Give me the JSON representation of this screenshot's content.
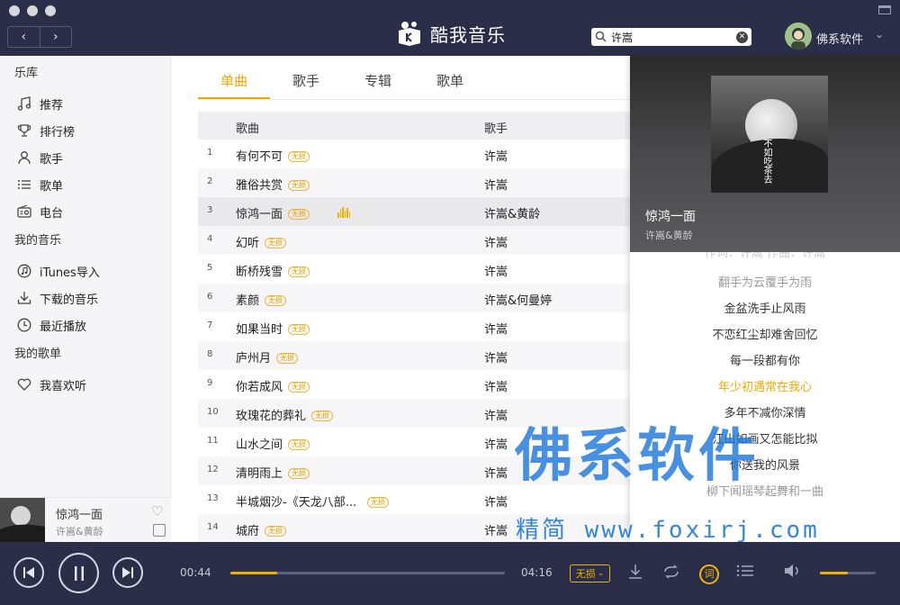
{
  "app": {
    "title": "酷我音乐"
  },
  "nav": {
    "back": "‹",
    "forward": "›"
  },
  "search": {
    "value": "许嵩",
    "placeholder": ""
  },
  "user": {
    "name": "佛系软件"
  },
  "sidebar": {
    "library_heading": "乐库",
    "library_items": [
      {
        "label": "推荐",
        "icon": "music-note-icon"
      },
      {
        "label": "排行榜",
        "icon": "trophy-icon"
      },
      {
        "label": "歌手",
        "icon": "person-icon"
      },
      {
        "label": "歌单",
        "icon": "list-icon"
      },
      {
        "label": "电台",
        "icon": "radio-icon"
      }
    ],
    "my_music_heading": "我的音乐",
    "my_music_items": [
      {
        "label": "iTunes导入",
        "icon": "itunes-icon"
      },
      {
        "label": "下载的音乐",
        "icon": "download-icon"
      },
      {
        "label": "最近播放",
        "icon": "clock-icon"
      }
    ],
    "my_playlist_heading": "我的歌单",
    "my_playlist_items": [
      {
        "label": "我喜欢听",
        "icon": "heart-icon"
      }
    ]
  },
  "now_playing": {
    "title": "惊鸿一面",
    "artist": "许嵩&黄龄"
  },
  "tabs": [
    {
      "label": "单曲",
      "active": true
    },
    {
      "label": "歌手",
      "active": false
    },
    {
      "label": "专辑",
      "active": false
    },
    {
      "label": "歌单",
      "active": false
    }
  ],
  "table": {
    "headers": {
      "song": "歌曲",
      "artist": "歌手"
    },
    "lossless_badge": "无损",
    "rows": [
      {
        "num": "1",
        "title": "有何不可",
        "artist": "许嵩"
      },
      {
        "num": "2",
        "title": "雅俗共赏",
        "artist": "许嵩"
      },
      {
        "num": "3",
        "title": "惊鸿一面",
        "artist": "许嵩&黄龄"
      },
      {
        "num": "4",
        "title": "幻听",
        "artist": "许嵩"
      },
      {
        "num": "5",
        "title": "断桥残雪",
        "artist": "许嵩"
      },
      {
        "num": "6",
        "title": "素颜",
        "artist": "许嵩&何曼婷"
      },
      {
        "num": "7",
        "title": "如果当时",
        "artist": "许嵩"
      },
      {
        "num": "8",
        "title": "庐州月",
        "artist": "许嵩"
      },
      {
        "num": "9",
        "title": "你若成风",
        "artist": "许嵩"
      },
      {
        "num": "10",
        "title": "玫瑰花的葬礼",
        "artist": "许嵩"
      },
      {
        "num": "11",
        "title": "山水之间",
        "artist": "许嵩"
      },
      {
        "num": "12",
        "title": "清明雨上",
        "artist": "许嵩"
      },
      {
        "num": "13",
        "title": "半城烟沙-《天龙八部...",
        "artist": "许嵩"
      },
      {
        "num": "14",
        "title": "城府",
        "artist": "许嵩"
      }
    ]
  },
  "panel": {
    "title": "惊鸿一面",
    "artist": "许嵩&黄龄",
    "album_text": "不如吃茶去",
    "lyrics": [
      {
        "text": "作词：许嵩 作曲：许嵩",
        "style": "faint"
      },
      {
        "text": "翻手为云覆手为雨",
        "style": "dim"
      },
      {
        "text": "金盆洗手止风雨",
        "style": "normal"
      },
      {
        "text": "不恋红尘却难舍回忆",
        "style": "normal"
      },
      {
        "text": "每一段都有你",
        "style": "normal"
      },
      {
        "text": "年少初遇常在我心",
        "style": "current"
      },
      {
        "text": "多年不减你深情",
        "style": "normal"
      },
      {
        "text": "江山如画又怎能比拟",
        "style": "normal"
      },
      {
        "text": "你送我的风景",
        "style": "normal"
      },
      {
        "text": "柳下闻瑶琴起舞和一曲",
        "style": "dim"
      }
    ]
  },
  "watermark": {
    "text": "佛系软件",
    "sub": "精简 www.foxirj.com"
  },
  "player": {
    "elapsed": "00:44",
    "total": "04:16",
    "progress": 0.17,
    "quality": "无损",
    "lyrics_btn": "词",
    "volume": 0.5,
    "accent": "#f0b400"
  }
}
